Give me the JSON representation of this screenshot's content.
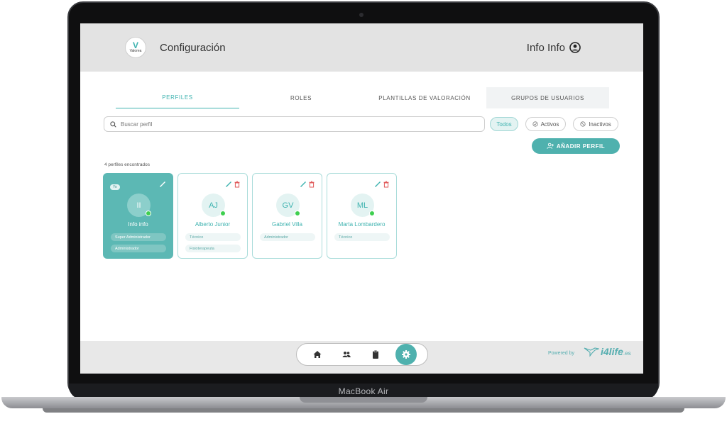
{
  "device": {
    "model_label": "MacBook Air"
  },
  "header": {
    "logo_text": "Valorea",
    "title": "Configuración",
    "user_name": "Info Info"
  },
  "tabs": [
    {
      "label": "PERFILES",
      "active": true
    },
    {
      "label": "ROLES",
      "active": false
    },
    {
      "label": "PLANTILLAS DE VALORACIÓN",
      "active": false
    },
    {
      "label": "GRUPOS DE USUARIOS",
      "active": false
    }
  ],
  "search": {
    "placeholder": "Buscar perfil",
    "value": ""
  },
  "filters": {
    "all": "Todos",
    "active": "Activos",
    "inactive": "Inactivos",
    "selected": "Todos"
  },
  "add_button": {
    "label": "AÑADIR PERFIL"
  },
  "results_text": "4 perfiles encontrados",
  "profiles": [
    {
      "initials": "II",
      "name": "Info info",
      "badge": "Yo",
      "roles": [
        "Super Administrador",
        "Administrador"
      ],
      "online": true,
      "is_current_user": true
    },
    {
      "initials": "AJ",
      "name": "Alberto Junior",
      "roles": [
        "Técnico",
        "Fisioterapeuta"
      ],
      "online": true
    },
    {
      "initials": "GV",
      "name": "Gabriel Villa",
      "roles": [
        "Administrador"
      ],
      "online": true
    },
    {
      "initials": "ML",
      "name": "Marta Lombardero",
      "roles": [
        "Técnico"
      ],
      "online": true
    }
  ],
  "dock": [
    {
      "icon": "home-icon",
      "active": false
    },
    {
      "icon": "users-icon",
      "active": false
    },
    {
      "icon": "clipboard-icon",
      "active": false
    },
    {
      "icon": "settings-gear-icon",
      "active": true
    }
  ],
  "footer": {
    "powered_by": "Powered by",
    "brand_main": "i4life",
    "brand_tld": ".es"
  },
  "colors": {
    "accent": "#4fb1ae",
    "online": "#3ecf4f",
    "delete": "#e05a5a",
    "header_bg": "#e3e3e3"
  }
}
